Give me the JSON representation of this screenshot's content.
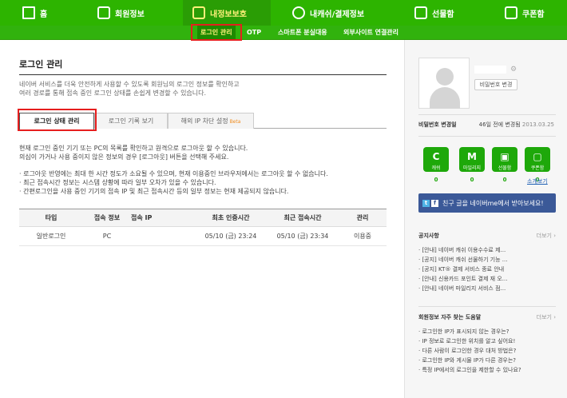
{
  "topnav": {
    "items": [
      {
        "label": "홈",
        "icon": "home-icon"
      },
      {
        "label": "회원정보",
        "icon": "profile-icon"
      },
      {
        "label": "내정보보호",
        "icon": "lock-icon"
      },
      {
        "label": "내캐쉬/결제정보",
        "icon": "cash-icon"
      },
      {
        "label": "선물함",
        "icon": "gift-icon"
      },
      {
        "label": "쿠폰함",
        "icon": "coupon-icon"
      }
    ]
  },
  "subnav": {
    "items": [
      "로그인 관리",
      "OTP",
      "스마트폰 분실대응",
      "외부사이트 연결관리"
    ]
  },
  "main": {
    "title": "로그인 관리",
    "desc1": "네이버 서비스를 더욱 안전하게 사용할 수 있도록 회원님의 로그인 정보를 확인하고",
    "desc2": "여러 경로를 통해 접속 중인 로그인 상태를 손쉽게 변경할 수 있습니다.",
    "tabs": [
      "로그인 상태 관리",
      "로그인 기록 보기",
      "해외 IP 차단 설정"
    ],
    "beta": "Beta",
    "info1": "현재 로그인 중인 기기 또는 PC의 목록를 확인하고 원격으로 로그아웃 할 수 있습니다.",
    "info2": "의심이 가거나 사용 중이지 않은 정보의 경우 [로그아웃] 버튼을 선택해 주세요.",
    "note1": "· 로그아웃 반영에는 최대 한 시간 정도가 소요될 수 있으며, 현재 이용중인 브라우저에서는 로그아웃 할 수 없습니다.",
    "note2": "· 최근 접속시간 정보는 시스템 상황에 따라 일부 오차가 있을 수 있습니다.",
    "note3": "· 간편로그인을 사용 중인 기기의 접속 IP 및 최근 접속시간 등의 일부 정보는 현재 제공되지 않습니다.",
    "table": {
      "headers": [
        "타입",
        "접속 정보",
        "접속 IP",
        "최초 인증시간",
        "최근 접속시간",
        "관리"
      ],
      "rows": [
        {
          "type": "일반로그인",
          "info": "PC",
          "ip": "",
          "first": "05/10 (금) 23:24",
          "last": "05/10 (금) 23:34",
          "manage": "이용중"
        }
      ]
    }
  },
  "side": {
    "pw_button": "비밀번호 변경",
    "pw_label": "비밀번호 변경일",
    "pw_value": "46일 전에 변경됨",
    "pw_date": "2013.03.25",
    "services": [
      {
        "label": "캐쉬",
        "glyph": "C",
        "count": "0"
      },
      {
        "label": "마일리지",
        "glyph": "M",
        "count": "0"
      },
      {
        "label": "선물함",
        "glyph": "▣",
        "count": "0"
      },
      {
        "label": "쿠폰함",
        "glyph": "▢",
        "count": "0"
      }
    ],
    "vouch_link": "소개보기",
    "fb_text": "친구 글을 네이버me에서 받아보세요!",
    "notice": {
      "title": "공지사항",
      "more": "더보기",
      "items": [
        "· [안내] 네이버 캐쉬 이용수수료 제...",
        "· [공지] 네이버 캐쉬 선물하기 기능 ...",
        "· [공지] KT® 결제 서비스 종료 안내",
        "· [안내] 신용카드 포인트 결제 재 오...",
        "· [안내] 네이버 마일리지 서비스 점..."
      ]
    },
    "faq": {
      "title": "회원정보 자주 찾는 도움말",
      "more": "더보기",
      "items": [
        "· 로그인한 IP가 표시되지 않는 경우는?",
        "· IP 정보로 로그인한 위치를 알고 싶어요!",
        "· 다른 사람이 로그인한 경우 대처 방법은?",
        "· 로그인한 IP와 게시물 IP가 다른 경우는?",
        "· 특정 IP에서의 로그인을 제한할 수 있나요?"
      ]
    }
  }
}
